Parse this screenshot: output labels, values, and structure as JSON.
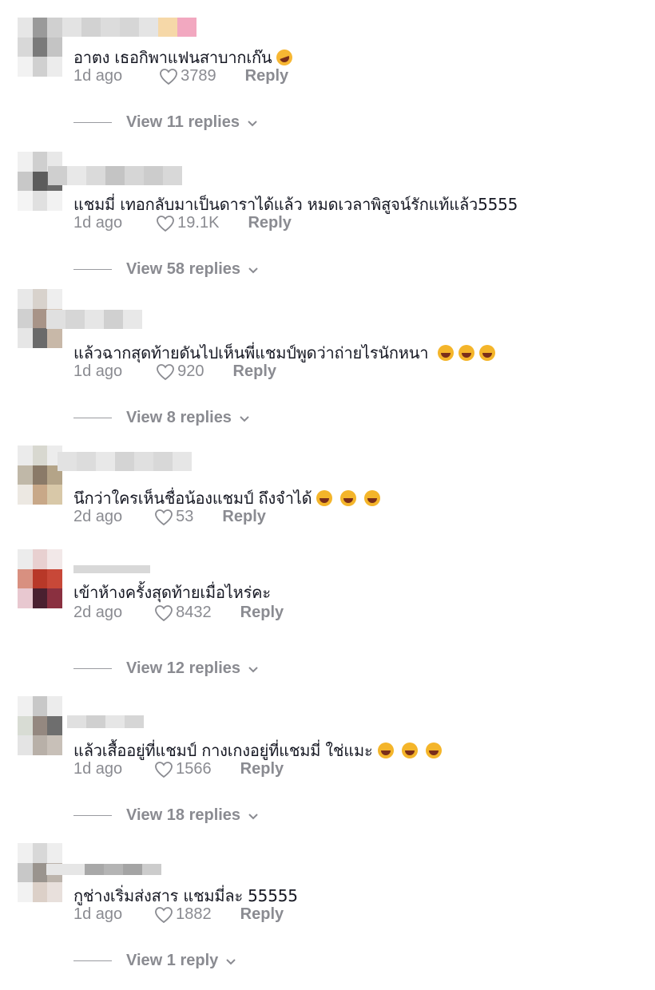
{
  "comments": [
    {
      "text": "อาตง เธอกิพาแฟนสาบากเก๊น",
      "emoji": "rofl",
      "emoji_count": 1,
      "time": "1d ago",
      "likes": "3789",
      "reply_label": "Reply",
      "view_replies": "View 11 replies"
    },
    {
      "text": "แชมมี่ เทอกลับมาเป็นดาราได้แล้ว หมดเวลาพิสูจน์รักแท้แล้ว5555",
      "emoji": "",
      "emoji_count": 0,
      "time": "1d ago",
      "likes": "19.1K",
      "reply_label": "Reply",
      "view_replies": "View 58 replies"
    },
    {
      "text": "แล้วฉากสุดท้ายดันไปเห็นพี่แชมป์พูดว่าถ่ายไรนักหนา",
      "emoji": "joy",
      "emoji_count": 3,
      "time": "1d ago",
      "likes": "920",
      "reply_label": "Reply",
      "view_replies": "View 8 replies"
    },
    {
      "text": "นึกว่าใครเห็นชื่อน้องแชมป์ ถึงจำได้",
      "emoji": "sweat-smile",
      "emoji_count": 3,
      "time": "2d ago",
      "likes": "53",
      "reply_label": "Reply",
      "view_replies": ""
    },
    {
      "text": "เข้าห้างครั้งสุดท้ายเมื่อไหร่คะ",
      "emoji": "",
      "emoji_count": 0,
      "time": "2d ago",
      "likes": "8432",
      "reply_label": "Reply",
      "view_replies": "View 12 replies"
    },
    {
      "text": "แล้วเสื้ออยู่ที่แชมป์ กางเกงอยู่ที่แชมมี่ ใช่แมะ",
      "emoji": "sweat-smile",
      "emoji_count": 3,
      "time": "1d ago",
      "likes": "1566",
      "reply_label": "Reply",
      "view_replies": "View 18 replies"
    },
    {
      "text": "กูช่างเริ่มส่งสาร แชมมี่ละ 55555",
      "emoji": "",
      "emoji_count": 0,
      "time": "1d ago",
      "likes": "1882",
      "reply_label": "Reply",
      "view_replies": "View 1 reply"
    }
  ],
  "colors": {
    "text": "#161823",
    "muted": "#8a8b91"
  },
  "icons": {
    "like": "heart-outline-icon",
    "expand": "chevron-down-icon"
  }
}
